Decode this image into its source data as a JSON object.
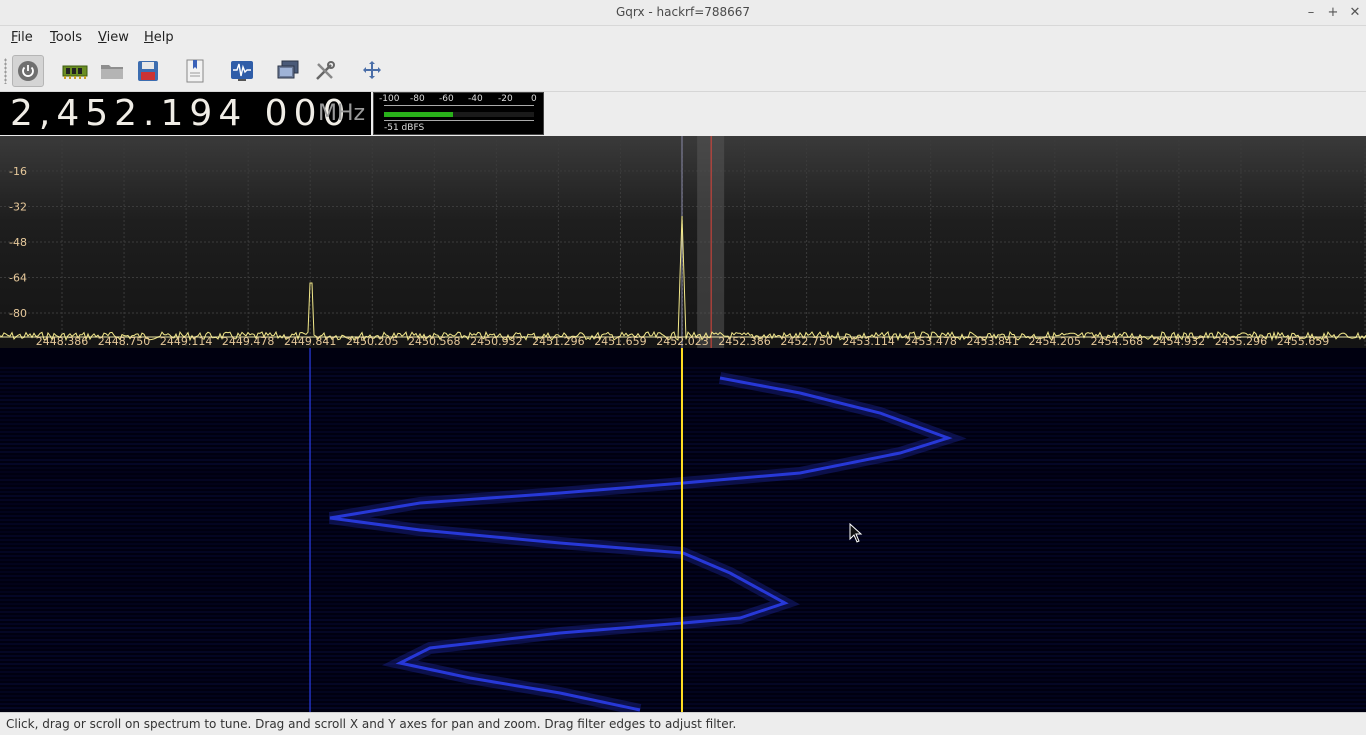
{
  "window": {
    "title": "Gqrx  - hackrf=788667"
  },
  "menu": [
    {
      "label": "File",
      "underline": "F"
    },
    {
      "label": "Tools",
      "underline": "T"
    },
    {
      "label": "View",
      "underline": "V"
    },
    {
      "label": "Help",
      "underline": "H"
    }
  ],
  "toolbar": {
    "icons": [
      "power-icon",
      "hardware-icon",
      "open-folder-icon",
      "save-icon",
      "bookmark-icon",
      "waveform-icon",
      "network-icon",
      "settings-icon",
      "fullscreen-icon"
    ]
  },
  "frequency": {
    "digits": "2,452.194 000",
    "unit": "MHz"
  },
  "meter": {
    "scale": [
      "-100",
      "-80",
      "-60",
      "-40",
      "-20",
      "0"
    ],
    "level_fraction": 0.46,
    "reading": "-51 dBFS"
  },
  "spectrum": {
    "y_ticks": [
      "-16",
      "-32",
      "-48",
      "-64",
      "-80"
    ],
    "x_ticks": [
      "2448.386",
      "2448.750",
      "2449.114",
      "2449.478",
      "2449.841",
      "2450.205",
      "2450.568",
      "2450.932",
      "2451.296",
      "2451.659",
      "2452.023",
      "2452.386",
      "2452.750",
      "2453.114",
      "2453.478",
      "2453.841",
      "2454.205",
      "2454.568",
      "2454.932",
      "2455.296",
      "2455.659"
    ],
    "peaks_mhz": [
      2449.841,
      2452.023
    ],
    "tuned_mhz": 2452.194,
    "colors": {
      "trace": "#f2e88a",
      "tick_text": "#e6c89a",
      "marker": "#e0443a",
      "peak": "#ffe34d"
    }
  },
  "waterfall": {
    "colors": {
      "signal": "#2a3de8",
      "line": "#ffdd22"
    }
  },
  "status": {
    "text": "Click, drag or scroll on spectrum to tune. Drag and scroll X and Y axes for pan and zoom. Drag filter edges to adjust filter."
  }
}
